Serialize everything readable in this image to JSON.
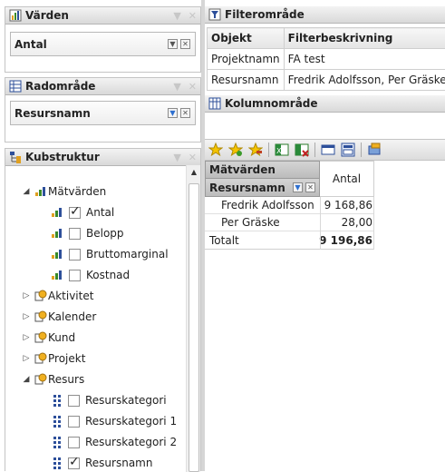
{
  "values_panel": {
    "title": "Värden",
    "field": "Antal"
  },
  "row_panel": {
    "title": "Radområde",
    "field": "Resursnamn"
  },
  "cube_panel": {
    "title": "Kubstruktur",
    "tree": {
      "measures": {
        "label": "Mätvärden",
        "items": [
          {
            "label": "Antal",
            "checked": true
          },
          {
            "label": "Belopp",
            "checked": false
          },
          {
            "label": "Bruttomarginal",
            "checked": false
          },
          {
            "label": "Kostnad",
            "checked": false
          }
        ]
      },
      "dimensions": [
        {
          "label": "Aktivitet"
        },
        {
          "label": "Kalender"
        },
        {
          "label": "Kund"
        },
        {
          "label": "Projekt"
        },
        {
          "label": "Resurs"
        }
      ],
      "resurs_items": [
        {
          "label": "Resurskategori",
          "checked": false
        },
        {
          "label": "Resurskategori 1",
          "checked": false
        },
        {
          "label": "Resurskategori 2",
          "checked": false
        },
        {
          "label": "Resursnamn",
          "checked": true
        }
      ]
    }
  },
  "filter_panel": {
    "title": "Filterområde",
    "columns": [
      "Objekt",
      "Filterbeskrivning"
    ],
    "rows": [
      [
        "Projektnamn",
        "FA test"
      ],
      [
        "Resursnamn",
        "Fredrik Adolfsson, Per Gräske"
      ]
    ]
  },
  "column_panel": {
    "title": "Kolumnområde"
  },
  "pivot": {
    "measures_header": "Mätvärden",
    "row_header": "Resursnamn",
    "col_header": "Antal",
    "rows": [
      {
        "label": "Fredrik Adolfsson",
        "value": "9 168,86"
      },
      {
        "label": "Per Gräske",
        "value": "28,00"
      }
    ],
    "total": {
      "label": "Totalt",
      "value": "9 196,86"
    }
  },
  "colors": {
    "accent": "#2d4f9a",
    "header_bg": "#e2e2e2",
    "border": "#b5b5b5"
  }
}
